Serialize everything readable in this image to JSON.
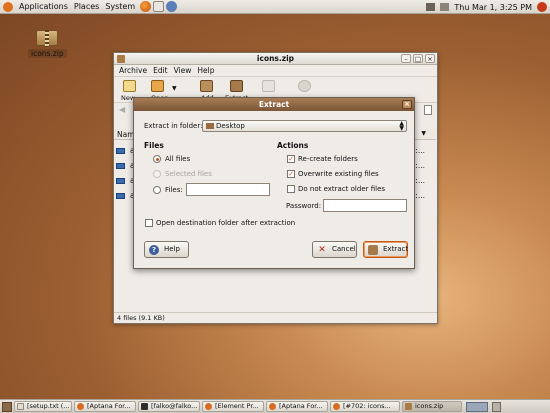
{
  "top_panel": {
    "menus": [
      "Applications",
      "Places",
      "System"
    ],
    "clock": "Thu Mar  1,  3:25 PM"
  },
  "desktop": {
    "icon_label": "icons.zip"
  },
  "main_window": {
    "title": "icons.zip",
    "menus": [
      "Archive",
      "Edit",
      "View",
      "Help"
    ],
    "toolbar": [
      "New",
      "Open",
      "Add",
      "Extract"
    ],
    "column_name": "Name",
    "rows": [
      {
        "name": "a",
        "date": "05:..."
      },
      {
        "name": "a",
        "date": "05:..."
      },
      {
        "name": "a",
        "date": "05:..."
      },
      {
        "name": "a",
        "date": "05:..."
      }
    ],
    "status": "4 files (9.1 KB)"
  },
  "dialog": {
    "title": "Extract",
    "extract_in_label": "Extract in folder:",
    "folder": "Desktop",
    "files_heading": "Files",
    "all_files": "All files",
    "selected_files": "Selected files",
    "files_option": "Files:",
    "actions_heading": "Actions",
    "recreate": "Re-create folders",
    "overwrite": "Overwrite existing files",
    "no_older": "Do not extract older files",
    "password_label": "Password:",
    "open_dest": "Open destination folder after extraction",
    "help_button": "Help",
    "cancel_button": "Cancel",
    "extract_button": "Extract",
    "state": {
      "all_files": true,
      "recreate": true,
      "overwrite": true,
      "no_older": false,
      "open_dest": false
    }
  },
  "taskbar": [
    {
      "label": "[setup.txt (..."
    },
    {
      "label": "[Aptana For..."
    },
    {
      "label": "[falko@falko..."
    },
    {
      "label": "[Element Pr..."
    },
    {
      "label": "[Aptana For..."
    },
    {
      "label": "[#702: icons..."
    },
    {
      "label": "icons.zip"
    }
  ],
  "colors": {
    "accent": "#c25b16",
    "title_active": "#8c6240",
    "desktop": "#9c5f31"
  }
}
